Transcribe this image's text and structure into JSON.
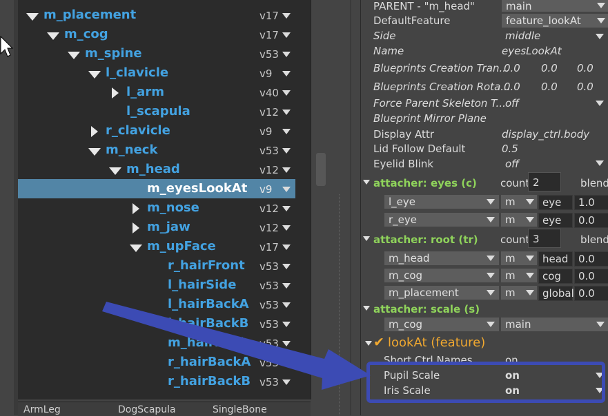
{
  "outliner": {
    "rows": [
      {
        "name": "m_placement",
        "ver": "v17",
        "indent": 0,
        "expander": "down",
        "selected": false
      },
      {
        "name": "m_cog",
        "ver": "v17",
        "indent": 1,
        "expander": "down",
        "selected": false
      },
      {
        "name": "m_spine",
        "ver": "v53",
        "indent": 2,
        "expander": "down",
        "selected": false
      },
      {
        "name": "l_clavicle",
        "ver": "v9",
        "indent": 3,
        "expander": "down",
        "selected": false
      },
      {
        "name": "l_arm",
        "ver": "v40",
        "indent": 4,
        "expander": "right",
        "selected": false
      },
      {
        "name": "l_scapula",
        "ver": "v12",
        "indent": 4,
        "expander": "none",
        "selected": false
      },
      {
        "name": "r_clavicle",
        "ver": "v9",
        "indent": 3,
        "expander": "right",
        "selected": false
      },
      {
        "name": "m_neck",
        "ver": "v53",
        "indent": 3,
        "expander": "down",
        "selected": false
      },
      {
        "name": "m_head",
        "ver": "v12",
        "indent": 4,
        "expander": "down",
        "selected": false
      },
      {
        "name": "m_eyesLookAt",
        "ver": "v9",
        "indent": 5,
        "expander": "none",
        "selected": true
      },
      {
        "name": "m_nose",
        "ver": "v12",
        "indent": 5,
        "expander": "right",
        "selected": false
      },
      {
        "name": "m_jaw",
        "ver": "v12",
        "indent": 5,
        "expander": "right",
        "selected": false
      },
      {
        "name": "m_upFace",
        "ver": "v17",
        "indent": 5,
        "expander": "down",
        "selected": false
      },
      {
        "name": "r_hairFront",
        "ver": "v53",
        "indent": 6,
        "expander": "none",
        "selected": false
      },
      {
        "name": "l_hairSide",
        "ver": "v53",
        "indent": 6,
        "expander": "none",
        "selected": false
      },
      {
        "name": "l_hairBackA",
        "ver": "v53",
        "indent": 6,
        "expander": "none",
        "selected": false
      },
      {
        "name": "l_hairBackB",
        "ver": "v53",
        "indent": 6,
        "expander": "none",
        "selected": false
      },
      {
        "name": "m_hairBack",
        "ver": "v53",
        "indent": 6,
        "expander": "none",
        "selected": false
      },
      {
        "name": "r_hairBackA",
        "ver": "v53",
        "indent": 6,
        "expander": "none",
        "selected": false
      },
      {
        "name": "r_hairBackB",
        "ver": "v53",
        "indent": 6,
        "expander": "none",
        "selected": false
      }
    ]
  },
  "bottom_tabs": [
    "ArmLeg",
    "DogScapula",
    "SingleBone"
  ],
  "attributes": {
    "parent_label": "PARENT - \"m_head\"",
    "parent_value": "main",
    "default_feature_label": "DefaultFeature",
    "default_feature_value": "feature_lookAt",
    "side_label": "Side",
    "side_value": "middle",
    "name_label": "Name",
    "name_value": "eyesLookAt",
    "bp_trans_label": "Blueprints Creation Tran...",
    "bp_trans": [
      "0.0",
      "0.0",
      "0.0"
    ],
    "bp_rot_label": "Blueprints Creation Rota...",
    "bp_rot": [
      "0.0",
      "0.0",
      "0.0"
    ],
    "force_parent_label": "Force Parent Skeleton T...",
    "force_parent_value": "off",
    "mirror_plane_label": "Blueprint Mirror Plane",
    "display_attr_label": "Display Attr",
    "display_attr_value": "display_ctrl.body",
    "lid_follow_label": "Lid Follow Default",
    "lid_follow_value": "0.5",
    "eyelid_blink_label": "Eyelid Blink",
    "eyelid_blink_value": "off"
  },
  "attacher_eyes": {
    "title": "attacher: eyes (c)",
    "count_label": "count",
    "count": "2",
    "blend_label": "blend",
    "rows": [
      {
        "target": "l_eye",
        "mode": "m",
        "attr": "eye",
        "value": "1.0"
      },
      {
        "target": "r_eye",
        "mode": "m",
        "attr": "eye",
        "value": "0.0"
      }
    ]
  },
  "attacher_root": {
    "title": "attacher: root (tr)",
    "count_label": "count",
    "count": "3",
    "blend_label": "blend",
    "rows": [
      {
        "target": "m_head",
        "mode": "m",
        "attr": "head",
        "value": "0.0"
      },
      {
        "target": "m_cog",
        "mode": "m",
        "attr": "cog",
        "value": "0.0"
      },
      {
        "target": "m_placement",
        "mode": "m",
        "attr": "global",
        "value": "0.0"
      }
    ]
  },
  "attacher_scale": {
    "title": "attacher: scale (s)",
    "target": "m_cog",
    "mode": "main"
  },
  "feature": {
    "check": "✔",
    "title": "lookAt (feature)",
    "short_ctrl_label": "Short Ctrl Names",
    "short_ctrl_value": "on",
    "pupil_label": "Pupil Scale",
    "pupil_value": "on",
    "iris_label": "Iris Scale",
    "iris_value": "on"
  },
  "colors": {
    "outliner_text": "#43a2e1",
    "selection": "#5285a6",
    "section_title": "#8fd35b",
    "feature_title": "#f0a830",
    "annotation": "#3c4bb4"
  }
}
